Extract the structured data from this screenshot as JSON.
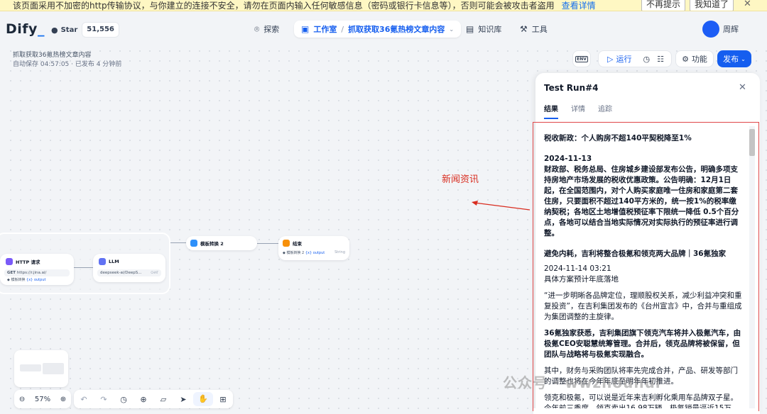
{
  "warning_bar": {
    "text": "该页面采用不加密的http传输协议，与你建立的连接不安全，请勿在页面内输入任何敏感信息（密码或银行卡信息等），否则可能会被攻击者盗用",
    "link": "查看详情",
    "dismiss_label": "不再提示",
    "ok_label": "我知道了",
    "close": "✕"
  },
  "header": {
    "logo": "Dify",
    "github_label": "Star",
    "github_stars": "51,556",
    "nav_explore": "探索",
    "nav_studio": "工作室",
    "nav_app": "抓取获取36氪热榜文章内容",
    "nav_knowledge": "知识库",
    "nav_tools": "工具",
    "user_name": "周辉"
  },
  "toolbar": {
    "app_title": "抓取获取36氪热榜文章内容",
    "autosave": "自动保存 04:57:05 · 已发布 4 分钟前",
    "env_label": "ENV",
    "run_label": "运行",
    "features_label": "功能",
    "publish_label": "发布"
  },
  "nodes": {
    "http": {
      "title": "HTTP 请求",
      "method": "GET",
      "url": "https://r.jina.ai/",
      "var": "模板转换",
      "var_out": "{x} output"
    },
    "llm": {
      "title": "LLM",
      "model": "deepseek-ai/DeepS...",
      "mode": "CHAT"
    },
    "template": {
      "title": "模板转换 2"
    },
    "end": {
      "title": "结束",
      "var": "模板转换 2",
      "var_out": "{x} output",
      "type": "String"
    }
  },
  "canvas_controls": {
    "zoom": "57%"
  },
  "annotation": "新闻资讯",
  "panel": {
    "title": "Test Run#4",
    "tabs": [
      "结果",
      "详情",
      "追踪"
    ],
    "article": {
      "h1": "税收新政：个人购房不超140平契税降至1%",
      "date1": "2024-11-13",
      "p1": "财政部、税务总局、住房城乡建设部发布公告，明确多项支持房地产市场发展的税收优惠政策。公告明确：12月1日起，在全国范围内，对个人购买家庭唯一住房和家庭第二套住房，只要面积不超过140平方米的，统一按1%的税率缴纳契税；各地区土地增值税预征率下限统一降低 0.5个百分点，各地可以结合当地实际情况对实际执行的预征率进行调整。",
      "h2": "避免内耗，吉利将整合极氪和领克两大品牌｜36氪独家",
      "date2": "2024-11-14 03:21",
      "p2a": "具体方案预计年底落地",
      "p2b": "“进一步明晰各品牌定位，理顺股权关系，减少利益冲突和重复投资”，在吉利集团发布的《台州宣言》中，合并与重组成为集团调整的主旋律。",
      "p2c": "36氪独家获悉，吉利集团旗下领克汽车将并入极氪汽车，由极氪CEO安聪慧统筹管理。合并后，领克品牌将被保留，但团队与战略将与极氪实现融合。",
      "p2d": "其中，财务与采购团队将率先完成合并，产品、研发等部门的调整也将在今年年底至明年年初推进。",
      "p2e": "领克和极氪，可以说是近年来吉利孵化乘用车品牌双子星。今年前三季度，领克卖出16.98万辆，极氪销量逼近15万"
    }
  },
  "watermark": "公众号 · wwzhouhui"
}
